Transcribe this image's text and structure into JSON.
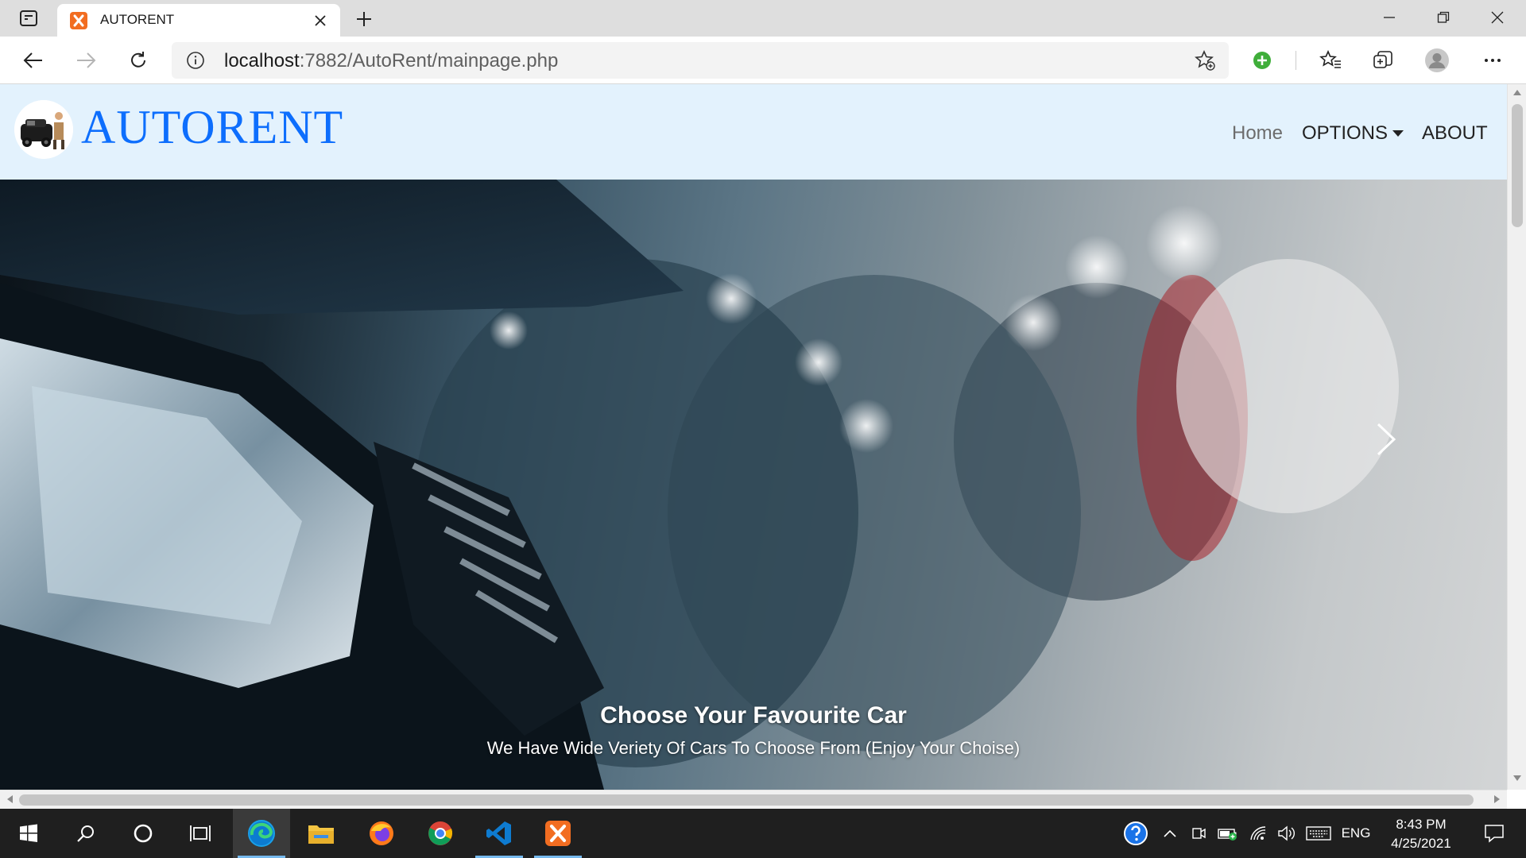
{
  "browser": {
    "tab_title": "AUTORENT",
    "url_host": "localhost",
    "url_rest": ":7882/AutoRent/mainpage.php"
  },
  "site": {
    "brand": "AUTORENT",
    "nav": {
      "home": "Home",
      "options": "OPTIONS",
      "about": "ABOUT"
    },
    "carousel": {
      "caption_title": "Choose Your Favourite Car",
      "caption_text": "We Have Wide Veriety Of Cars To Choose From (Enjoy Your Choise)"
    }
  },
  "taskbar": {
    "language": "ENG",
    "time": "8:43 PM",
    "date": "4/25/2021"
  },
  "colors": {
    "navbar_bg": "#e3f2fd",
    "brand_blue": "#0d6efd",
    "xampp_orange": "#f26d21",
    "taskbar_bg": "#1f1f1f"
  }
}
